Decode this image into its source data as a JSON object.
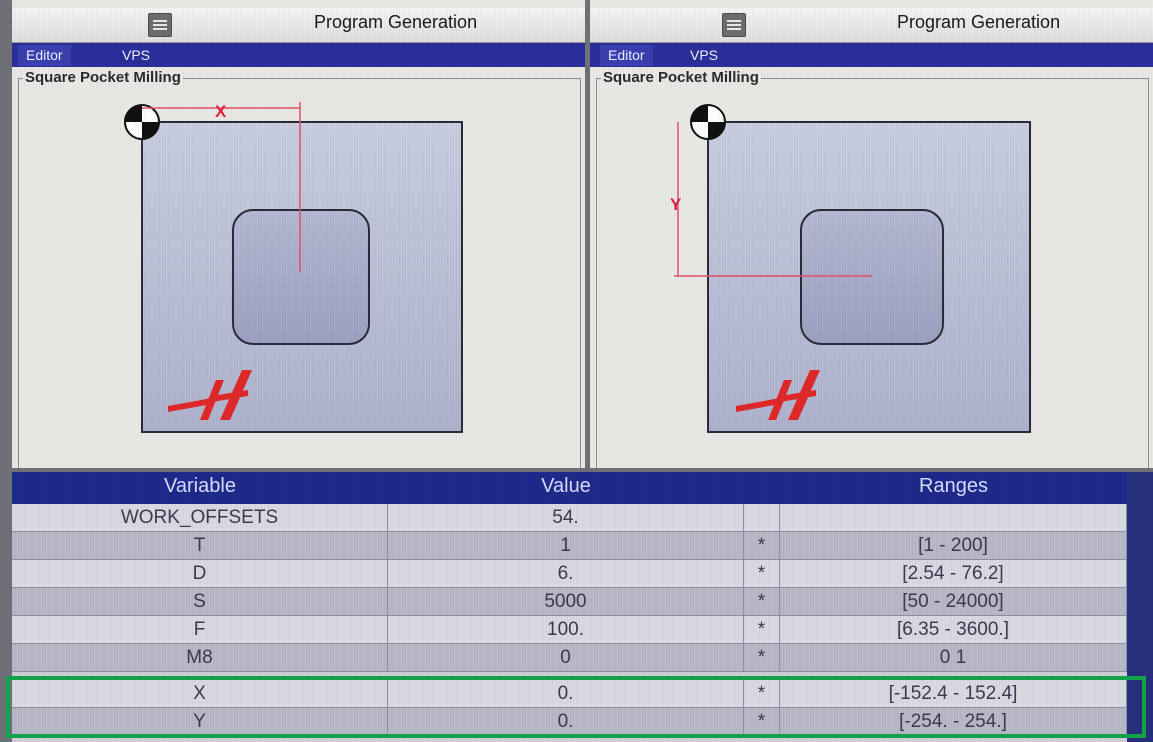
{
  "left_panel": {
    "title": "Program Generation",
    "tabs": [
      "Editor",
      "VPS"
    ],
    "group_label": "Square Pocket Milling",
    "dimension_label": "X",
    "icons": [
      "menu-icon",
      "origin-marker-icon",
      "haas-logo-icon"
    ]
  },
  "right_panel": {
    "title": "Program Generation",
    "tabs": [
      "Editor",
      "VPS"
    ],
    "group_label": "Square Pocket Milling",
    "dimension_label": "Y",
    "icons": [
      "menu-icon",
      "origin-marker-icon",
      "haas-logo-icon"
    ]
  },
  "table": {
    "headers": {
      "variable": "Variable",
      "value": "Value",
      "flag": "",
      "ranges": "Ranges"
    },
    "rows": [
      {
        "variable": "WORK_OFFSETS",
        "value": "54.",
        "flag": "",
        "range": ""
      },
      {
        "variable": "T",
        "value": "1",
        "flag": "*",
        "range": "[1 - 200]"
      },
      {
        "variable": "D",
        "value": "6.",
        "flag": "*",
        "range": "[2.54 - 76.2]"
      },
      {
        "variable": "S",
        "value": "5000",
        "flag": "*",
        "range": "[50 - 24000]"
      },
      {
        "variable": "F",
        "value": "100.",
        "flag": "*",
        "range": "[6.35 - 3600.]"
      },
      {
        "variable": "M8",
        "value": "0",
        "flag": "*",
        "range": "0 1"
      },
      {
        "variable": "X",
        "value": "0.",
        "flag": "*",
        "range": "[-152.4 - 152.4]"
      },
      {
        "variable": "Y",
        "value": "0.",
        "flag": "*",
        "range": "[-254. - 254.]"
      }
    ]
  },
  "colors": {
    "tab_bar": "#2a2f9a",
    "table_header": "#1d2a8a",
    "dimension_line": "#e2506a",
    "logo": "#e0282a",
    "highlight_box": "#12a24a"
  }
}
